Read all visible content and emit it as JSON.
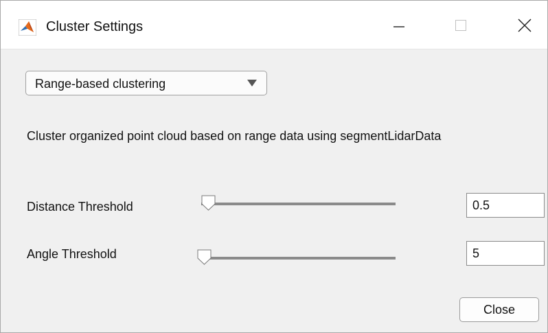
{
  "window": {
    "title": "Cluster Settings",
    "icon": "matlab-logo-icon",
    "controls": [
      "minimize-icon",
      "maximize-icon",
      "close-icon"
    ]
  },
  "method_dropdown": {
    "selected": "Range-based clustering"
  },
  "description": "Cluster organized point cloud based on range data using segmentLidarData",
  "parameters": [
    {
      "label": "Distance Threshold",
      "value": "0.5",
      "slider_position_fraction": 0.05
    },
    {
      "label": "Angle Threshold",
      "value": "5",
      "slider_position_fraction": 0.02
    }
  ],
  "close_button": {
    "label": "Close"
  },
  "colors": {
    "background": "#f0f0f0",
    "titlebar": "#ffffff",
    "slider_track": "#808080"
  }
}
